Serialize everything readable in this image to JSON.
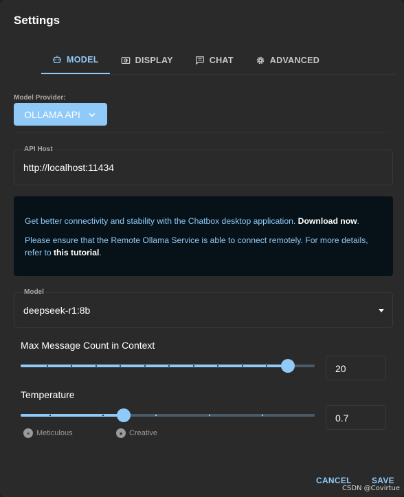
{
  "dialog": {
    "title": "Settings"
  },
  "tabs": [
    {
      "label": "MODEL",
      "icon": "robot-icon",
      "active": true
    },
    {
      "label": "DISPLAY",
      "icon": "display-icon",
      "active": false
    },
    {
      "label": "CHAT",
      "icon": "chat-icon",
      "active": false
    },
    {
      "label": "ADVANCED",
      "icon": "gear-icon",
      "active": false
    }
  ],
  "provider": {
    "label": "Model Provider:",
    "value": "OLLAMA API"
  },
  "api_host": {
    "label": "API Host",
    "value": "http://localhost:11434"
  },
  "notice": {
    "line1_text": "Get better connectivity and stability with the Chatbox desktop application. ",
    "line1_link": "Download now",
    "line1_end": ".",
    "line2_text": "Please ensure that the Remote Ollama Service is able to connect remotely. For more details, refer to ",
    "line2_link": "this tutorial",
    "line2_end": "."
  },
  "model": {
    "label": "Model",
    "value": "deepseek-r1:8b"
  },
  "max_messages": {
    "label": "Max Message Count in Context",
    "value": "20",
    "fraction": 0.91
  },
  "temperature": {
    "label": "Temperature",
    "value": "0.7",
    "fraction": 0.35,
    "hint_left": "Meticulous",
    "hint_right": "Creative"
  },
  "actions": {
    "cancel": "CANCEL",
    "save": "SAVE"
  },
  "watermark": "CSDN @Covirtue",
  "colors": {
    "accent": "#90caf9",
    "background": "#2a2a2a",
    "notice_bg": "#071218"
  }
}
